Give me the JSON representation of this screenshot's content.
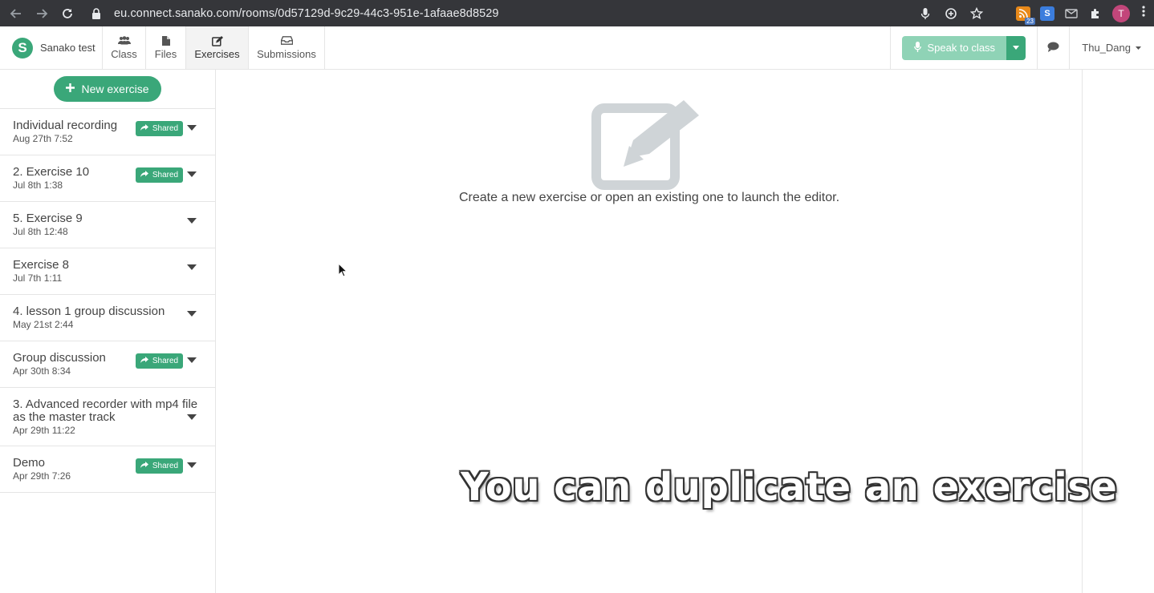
{
  "browser": {
    "url": "eu.connect.sanako.com/rooms/0d57129d-9c29-44c3-951e-1afaae8d8529",
    "ext_badge_count": "23",
    "s_ext_letter": "S",
    "profile_initial": "T"
  },
  "header": {
    "room_name": "Sanako test",
    "logo_letter": "S",
    "tabs": [
      {
        "label": "Class",
        "icon": "users-icon"
      },
      {
        "label": "Files",
        "icon": "file-icon"
      },
      {
        "label": "Exercises",
        "icon": "edit-icon",
        "active": true
      },
      {
        "label": "Submissions",
        "icon": "inbox-icon"
      }
    ],
    "speak_label": "Speak to class",
    "user_name": "Thu_Dang"
  },
  "sidebar": {
    "new_exercise_label": "New exercise",
    "shared_label": "Shared",
    "exercises": [
      {
        "title": "Individual recording",
        "date": "Aug 27th 7:52",
        "shared": true
      },
      {
        "title": "2. Exercise 10",
        "date": "Jul 8th 1:38",
        "shared": true
      },
      {
        "title": "5. Exercise 9",
        "date": "Jul 8th 12:48",
        "shared": false
      },
      {
        "title": "Exercise 8",
        "date": "Jul 7th 1:11",
        "shared": false
      },
      {
        "title": "4. lesson 1 group discussion",
        "date": "May 21st 2:44",
        "shared": false
      },
      {
        "title": "Group discussion",
        "date": "Apr 30th 8:34",
        "shared": true
      },
      {
        "title": "3. Advanced recorder with mp4 file as the master track",
        "date": "Apr 29th 11:22",
        "shared": false
      },
      {
        "title": "Demo",
        "date": "Apr 29th 7:26",
        "shared": true
      }
    ]
  },
  "main": {
    "editor_message": "Create a new exercise or open an existing one to launch the editor.",
    "caption": "You can duplicate an exercise"
  },
  "colors": {
    "brand_green": "#3aa779",
    "speak_disabled": "#8fd3b6",
    "chrome_bg": "#35363a",
    "icon_gray": "#cfd4d7"
  }
}
